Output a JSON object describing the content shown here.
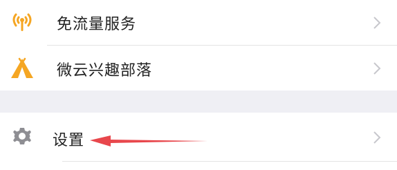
{
  "menu": {
    "items": [
      {
        "label": "免流量服务",
        "icon": "wifi-signal-icon",
        "icon_color": "#f5a623"
      },
      {
        "label": "微云兴趣部落",
        "icon": "tent-icon",
        "icon_color": "#f5a623"
      },
      {
        "label": "设置",
        "icon": "gear-icon",
        "icon_color": "#8e8e93"
      }
    ]
  },
  "annotation": {
    "arrow_color": "#e8474c",
    "icon": "red-arrow-pointer"
  }
}
